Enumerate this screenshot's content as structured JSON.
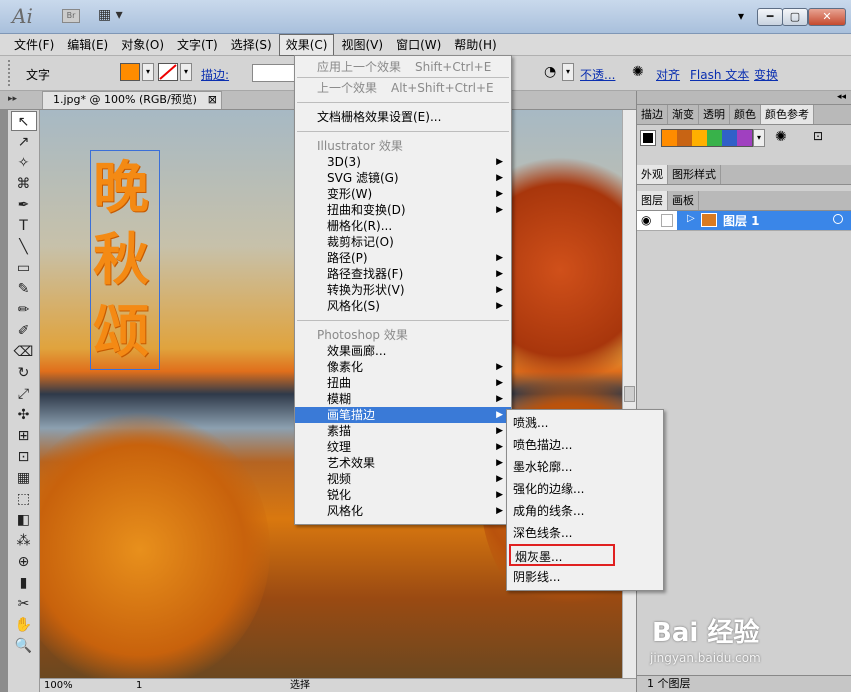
{
  "app": {
    "logo": "Ai",
    "bridge": "Br",
    "workspace_icon": "▦ ▾",
    "min": "▾",
    "minimize": "━",
    "restore": "▢",
    "close": "✕"
  },
  "menubar": [
    "文件(F)",
    "编辑(E)",
    "对象(O)",
    "文字(T)",
    "选择(S)",
    "效果(C)",
    "视图(V)",
    "窗口(W)",
    "帮助(H)"
  ],
  "control": {
    "label": "文字",
    "stroke_label": "描边:",
    "opacity_label": "不透...",
    "align": "对齐",
    "flash_text": "Flash 文本",
    "transform": "变换",
    "fill_color": "#ff8c00"
  },
  "document": {
    "tab": "1.jpg* @ 100% (RGB/预览)",
    "close": "⊠",
    "art_text": [
      "晚",
      "秋",
      "颂"
    ]
  },
  "status": {
    "zoom": "100%",
    "page": "1",
    "mode": "选择"
  },
  "effect_menu": {
    "items": [
      {
        "label": "应用上一个效果",
        "shortcut": "Shift+Ctrl+E",
        "disabled": true
      },
      {
        "label": "上一个效果",
        "shortcut": "Alt+Shift+Ctrl+E",
        "disabled": true
      }
    ],
    "raster_settings": "文档栅格效果设置(E)...",
    "illustrator_header": "Illustrator 效果",
    "illustrator_items": [
      "3D(3)",
      "SVG 滤镜(G)",
      "变形(W)",
      "扭曲和变换(D)",
      "栅格化(R)...",
      "裁剪标记(O)",
      "路径(P)",
      "路径查找器(F)",
      "转换为形状(V)",
      "风格化(S)"
    ],
    "photoshop_header": "Photoshop 效果",
    "photoshop_items": [
      "效果画廊...",
      "像素化",
      "扭曲",
      "模糊",
      "画笔描边",
      "素描",
      "纹理",
      "艺术效果",
      "视频",
      "锐化",
      "风格化"
    ]
  },
  "brush_submenu": [
    "喷溅...",
    "喷色描边...",
    "墨水轮廓...",
    "强化的边缘...",
    "成角的线条...",
    "深色线条...",
    "烟灰墨...",
    "阴影线..."
  ],
  "right_panel": {
    "top_tabs": [
      "描边",
      "渐变",
      "透明",
      "颜色",
      "颜色参考"
    ],
    "mid_tabs": [
      "外观",
      "图形样式"
    ],
    "layer_tabs": [
      "图层",
      "画板"
    ],
    "layer_name": "图层 1",
    "layer_count": "1 个图层",
    "guide_colors": [
      "#ff8c00",
      "#c86414",
      "#ffb000",
      "#38b24a",
      "#3060c8",
      "#a040c0"
    ]
  },
  "tools": [
    "↖",
    "↗",
    "✧",
    "⌘",
    "✒",
    "T",
    "╲",
    "▭",
    "✎",
    "✏",
    "✐",
    "⌫",
    "↻",
    "⤢",
    "✣",
    "⊞",
    "⊡",
    "▦",
    "⬚",
    "◧",
    "⁂",
    "⊕",
    "▮",
    "✂",
    "✋",
    "🔍"
  ],
  "watermark": {
    "brand": "Bai 经验",
    "url": "jingyan.baidu.com"
  }
}
